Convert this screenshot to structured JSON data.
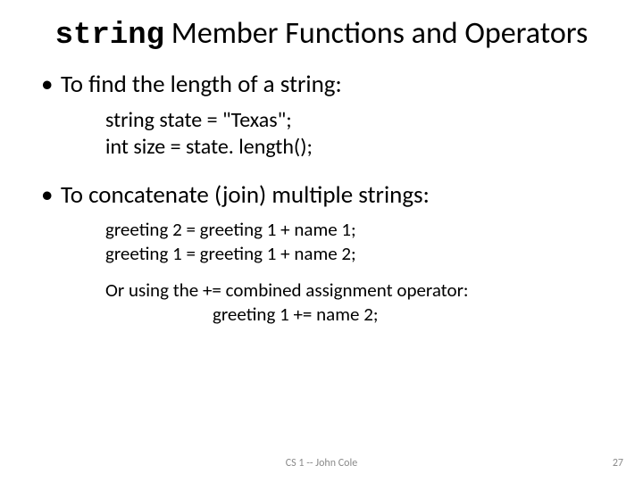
{
  "title": {
    "mono": "string",
    "rest": " Member Functions and Operators"
  },
  "bullets": {
    "length": "To find the length of a string:",
    "concat": "To concatenate (join) multiple strings:"
  },
  "code_length": {
    "l1": "string state = \"Texas\";",
    "l2": "int size = state. length();"
  },
  "code_concat": {
    "l1": "greeting 2 = greeting 1 + name 1;",
    "l2": "greeting 1 = greeting 1 + name 2;"
  },
  "note": {
    "l1": "Or using the += combined assignment operator:",
    "l2": "greeting 1 += name 2;"
  },
  "footer": {
    "center": "CS 1 -- John Cole",
    "right": "27"
  }
}
